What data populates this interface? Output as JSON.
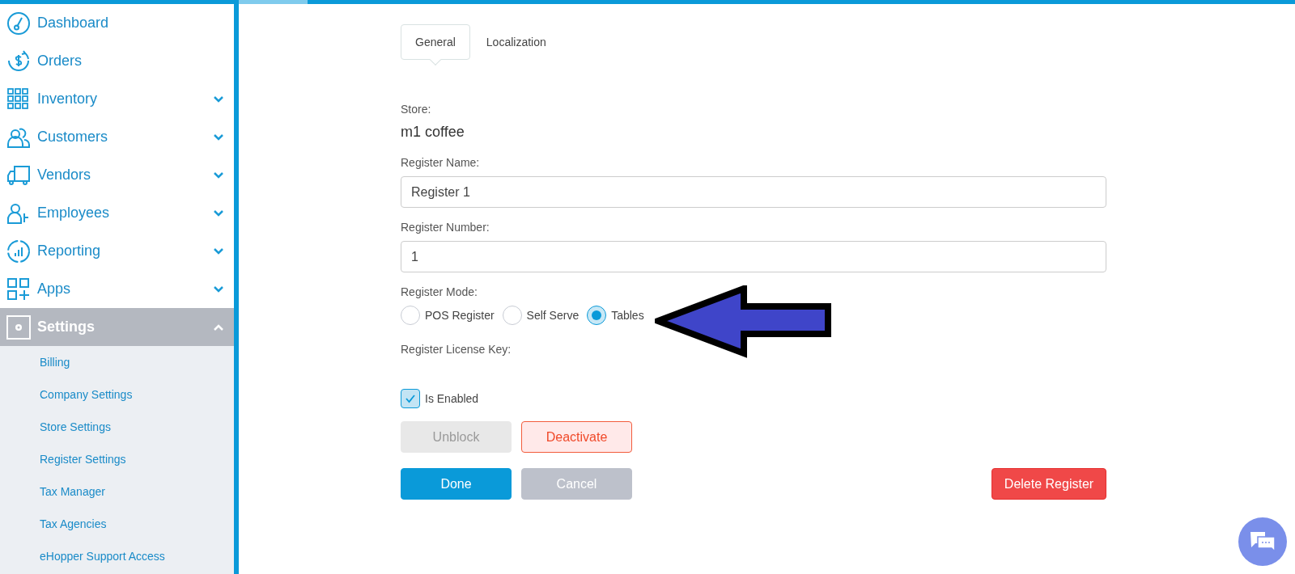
{
  "sidebar": {
    "items": [
      {
        "label": "Dashboard",
        "kind": "link",
        "selected": false
      },
      {
        "label": "Orders",
        "kind": "link",
        "selected": false
      },
      {
        "label": "Inventory",
        "kind": "group",
        "expanded": false,
        "selected": false
      },
      {
        "label": "Customers",
        "kind": "group",
        "expanded": false,
        "selected": false
      },
      {
        "label": "Vendors",
        "kind": "group",
        "expanded": false,
        "selected": false
      },
      {
        "label": "Employees",
        "kind": "group",
        "expanded": false,
        "selected": false
      },
      {
        "label": "Reporting",
        "kind": "group",
        "expanded": false,
        "selected": false
      },
      {
        "label": "Apps",
        "kind": "group",
        "expanded": false,
        "selected": false
      },
      {
        "label": "Settings",
        "kind": "group",
        "expanded": true,
        "selected": true,
        "children": [
          {
            "label": "Billing"
          },
          {
            "label": "Company Settings"
          },
          {
            "label": "Store Settings"
          },
          {
            "label": "Register Settings"
          },
          {
            "label": "Tax Manager"
          },
          {
            "label": "Tax Agencies"
          },
          {
            "label": "eHopper Support Access"
          }
        ]
      }
    ]
  },
  "tabs": [
    {
      "label": "General",
      "selected": true
    },
    {
      "label": "Localization",
      "selected": false
    }
  ],
  "store": {
    "label": "Store:",
    "value": "m1 coffee"
  },
  "fields": [
    {
      "label": "Register Name:",
      "value": "Register 1"
    },
    {
      "label": "Register Number:",
      "value": "1"
    }
  ],
  "register_mode": {
    "label": "Register Mode:",
    "options": [
      {
        "label": "POS Register",
        "selected": false
      },
      {
        "label": "Self Serve",
        "selected": false
      },
      {
        "label": "Tables",
        "selected": true
      }
    ]
  },
  "license_key": {
    "label": "Register License Key:"
  },
  "is_enabled": {
    "label": "Is Enabled",
    "checked": true
  },
  "buttons": [
    {
      "label": "Unblock",
      "kind": "disabled"
    },
    {
      "label": "Deactivate",
      "kind": "danger-outline"
    }
  ],
  "actions": [
    {
      "label": "Done",
      "kind": "primary"
    },
    {
      "label": "Cancel",
      "kind": "secondary"
    }
  ],
  "delete_button": {
    "label": "Delete Register"
  }
}
